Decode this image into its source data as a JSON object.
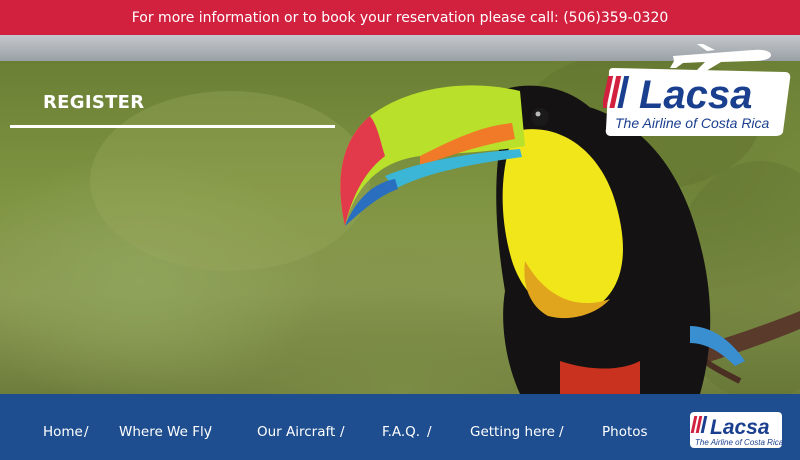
{
  "announcement": "For more information or to book your reservation please call: (506)359-0320",
  "hero": {
    "heading": "REGISTER"
  },
  "logo": {
    "wordmark": "Lacsa",
    "tagline": "The Airline of Costa Rica"
  },
  "nav": {
    "items": [
      {
        "label": "Home"
      },
      {
        "label": "Where We Fly"
      },
      {
        "label": "Our Aircraft"
      },
      {
        "label": "F.A.Q."
      },
      {
        "label": "Getting here"
      },
      {
        "label": "Photos"
      }
    ],
    "separator": "/"
  },
  "colors": {
    "announcement_bg": "#d2213f",
    "nav_bg": "#1e4e8f",
    "brand_blue": "#1b3f8f",
    "brand_red": "#d2213f"
  },
  "icons": [
    "airplane-icon",
    "lacsa-stripes-logo"
  ]
}
